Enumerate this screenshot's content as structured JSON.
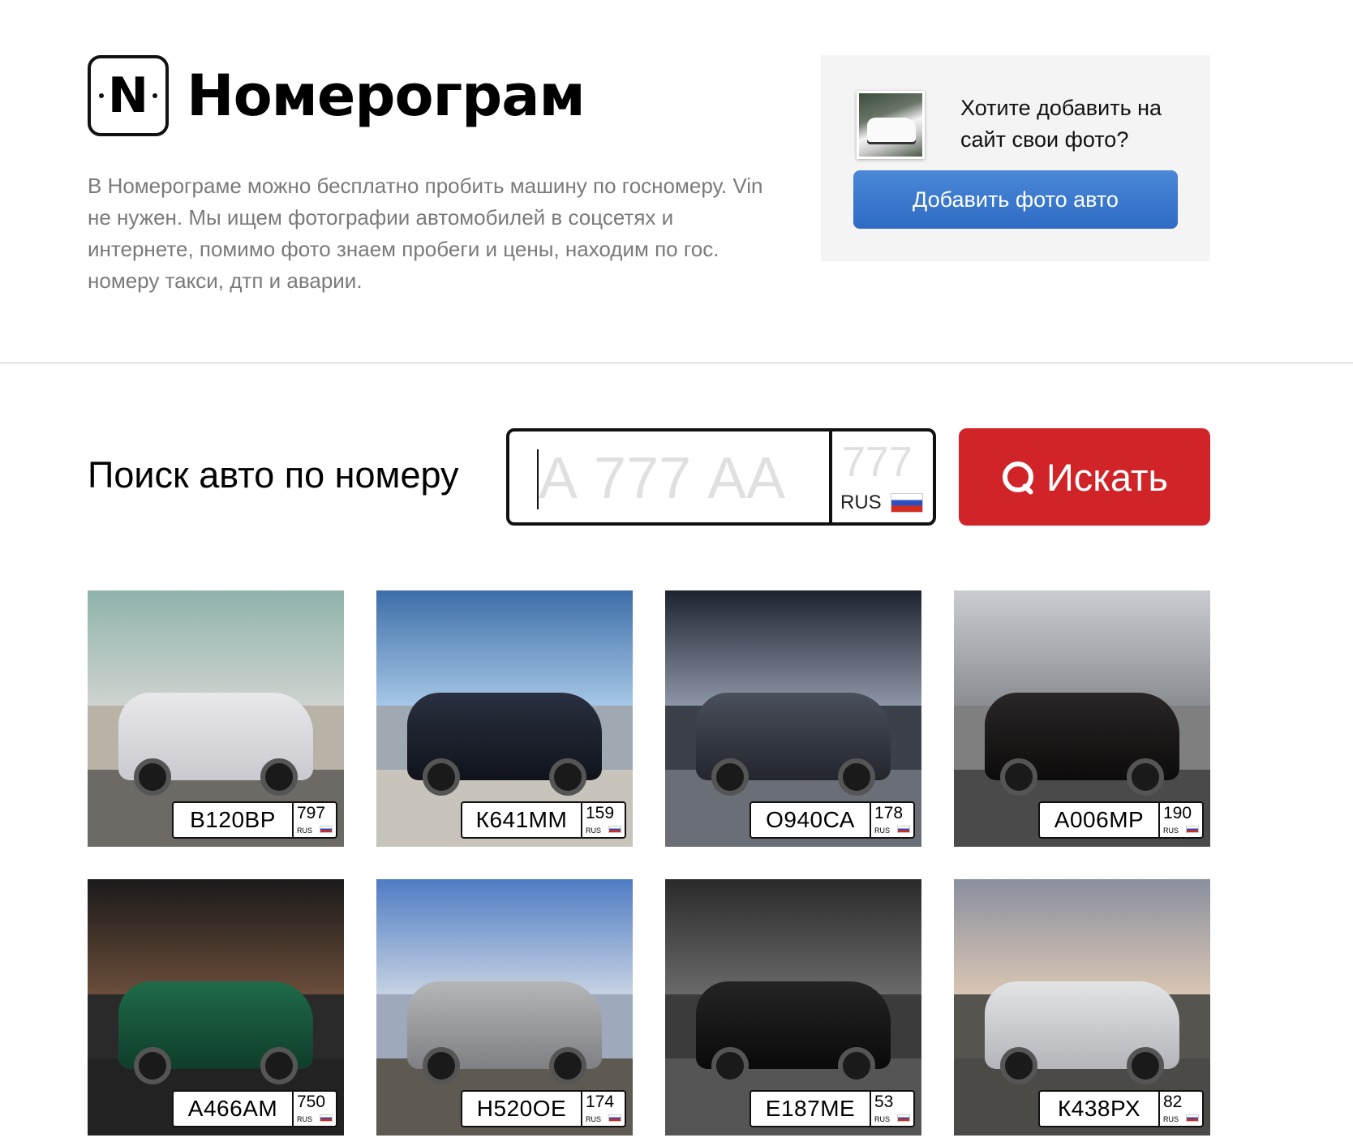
{
  "site": {
    "logo_letter": "N",
    "name": "Номерограм",
    "description": "В Номерограме можно бесплатно пробить машину по госномеру. Vin не нужен. Мы ищем фотографии автомобилей в соцсетях и интернете, помимо фото знаем пробеги и цены, находим по гос. номеру такси, дтп и аварии."
  },
  "promo": {
    "text": "Хотите добавить на сайт свои фото?",
    "button_label": "Добавить фото авто",
    "button_color": "#3a7bd5"
  },
  "search": {
    "label": "Поиск авто по номеру",
    "placeholder_number": "А 777 АА",
    "placeholder_region": "777",
    "country": "RUS",
    "button_label": "Искать",
    "button_color": "#d02429"
  },
  "cars": [
    {
      "number": "В120ВР",
      "region": "797",
      "country": "RUS"
    },
    {
      "number": "К641ММ",
      "region": "159",
      "country": "RUS"
    },
    {
      "number": "О940СА",
      "region": "178",
      "country": "RUS"
    },
    {
      "number": "А006МР",
      "region": "190",
      "country": "RUS"
    },
    {
      "number": "А466АМ",
      "region": "750",
      "country": "RUS"
    },
    {
      "number": "Н520ОЕ",
      "region": "174",
      "country": "RUS"
    },
    {
      "number": "Е187МЕ",
      "region": "53",
      "country": "RUS"
    },
    {
      "number": "К438РХ",
      "region": "82",
      "country": "RUS"
    }
  ]
}
